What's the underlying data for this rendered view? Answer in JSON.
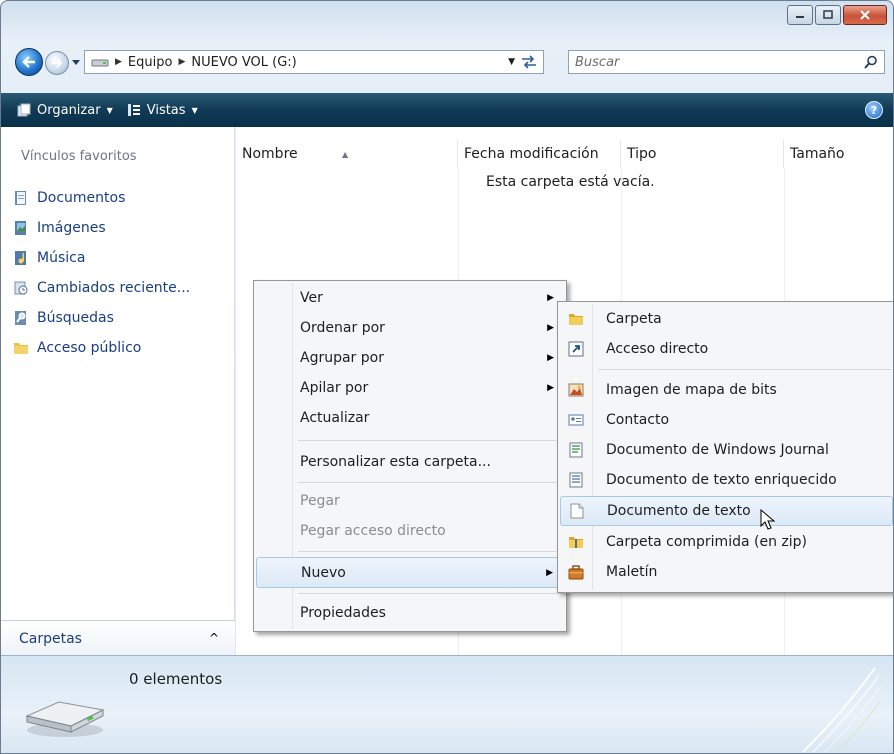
{
  "window": {
    "address_segments": [
      "Equipo",
      "NUEVO VOL (G:)"
    ],
    "search_placeholder": "Buscar"
  },
  "toolbar": {
    "organize_label": "Organizar",
    "views_label": "Vistas",
    "help_label": "?"
  },
  "nav": {
    "title": "Vínculos favoritos",
    "items": [
      {
        "label": "Documentos",
        "icon": "documents-icon"
      },
      {
        "label": "Imágenes",
        "icon": "pictures-icon"
      },
      {
        "label": "Música",
        "icon": "music-icon"
      },
      {
        "label": "Cambiados reciente...",
        "icon": "recent-icon"
      },
      {
        "label": "Búsquedas",
        "icon": "searches-icon"
      },
      {
        "label": "Acceso público",
        "icon": "public-folder-icon"
      }
    ],
    "folders_label": "Carpetas"
  },
  "columns": [
    "Nombre",
    "Fecha modificación",
    "Tipo",
    "Tamaño"
  ],
  "empty_message": "Esta carpeta está vacía.",
  "status": {
    "count": "0 elementos"
  },
  "context_menu": {
    "items": [
      {
        "label": "Ver",
        "submenu": true
      },
      {
        "label": "Ordenar por",
        "submenu": true
      },
      {
        "label": "Agrupar por",
        "submenu": true
      },
      {
        "label": "Apilar por",
        "submenu": true
      },
      {
        "label": "Actualizar"
      },
      {
        "label": "Personalizar esta carpeta..."
      },
      {
        "label": "Pegar",
        "disabled": true
      },
      {
        "label": "Pegar acceso directo",
        "disabled": true
      },
      {
        "label": "Nuevo",
        "submenu": true,
        "highlighted": true
      },
      {
        "label": "Propiedades"
      }
    ]
  },
  "new_submenu": {
    "items": [
      {
        "label": "Carpeta",
        "icon": "folder-icon"
      },
      {
        "label": "Acceso directo",
        "icon": "shortcut-icon"
      },
      {
        "label": "Imagen de mapa de bits",
        "icon": "bitmap-icon"
      },
      {
        "label": "Contacto",
        "icon": "contact-icon"
      },
      {
        "label": "Documento de Windows Journal",
        "icon": "journal-icon"
      },
      {
        "label": "Documento de texto enriquecido",
        "icon": "rtf-icon"
      },
      {
        "label": "Documento de texto",
        "icon": "text-document-icon",
        "highlighted": true
      },
      {
        "label": "Carpeta comprimida (en zip)",
        "icon": "zip-folder-icon"
      },
      {
        "label": "Maletín",
        "icon": "briefcase-icon"
      }
    ]
  }
}
